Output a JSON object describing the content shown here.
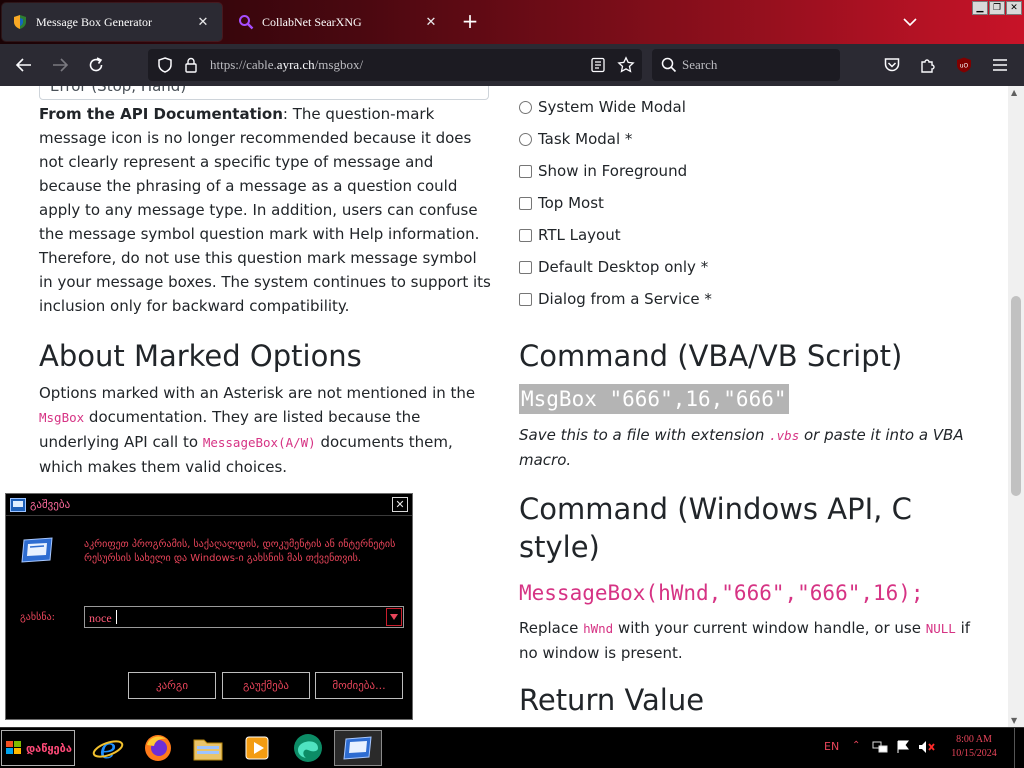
{
  "browser": {
    "tabs": [
      {
        "title": "Message Box Generator",
        "active": true,
        "icon": "shield-favicon"
      },
      {
        "title": "CollabNet SearXNG",
        "active": false,
        "icon": "search-favicon"
      }
    ],
    "url": {
      "prefix": "https://cable.",
      "domain": "ayra.ch",
      "path": "/msgbox/"
    },
    "search_placeholder": "Search"
  },
  "page": {
    "truncated_field": "Error (Stop, Hand)",
    "api_doc": {
      "heading": "From the API Documentation",
      "text": ": The question-mark message icon is no longer recommended because it does not clearly represent a specific type of message and because the phrasing of a message as a question could apply to any message type. In addition, users can confuse the message symbol question mark with Help information. Therefore, do not use this question mark message symbol in your message boxes. The system continues to support its inclusion only for backward compatibility."
    },
    "about": {
      "heading": "About Marked Options",
      "text_1": "Options marked with an Asterisk are not mentioned in the ",
      "code_1": "MsgBox",
      "text_2": " documentation. They are listed because the underlying API call to ",
      "code_2": "MessageBox(A/W)",
      "text_3": " documents them, which makes them valid choices."
    },
    "modality_options": [
      {
        "label": "System Wide Modal",
        "type": "radio",
        "checked": false
      },
      {
        "label": "Task Modal *",
        "type": "radio",
        "checked": false
      }
    ],
    "flag_options": [
      {
        "label": "Show in Foreground",
        "checked": false
      },
      {
        "label": "Top Most",
        "checked": false
      },
      {
        "label": "RTL Layout",
        "checked": false
      },
      {
        "label": "Default Desktop only *",
        "checked": false
      },
      {
        "label": "Dialog from a Service *",
        "checked": false
      }
    ],
    "vba": {
      "heading": "Command (VBA/VB Script)",
      "command": "MsgBox \"666\",16,\"666\"",
      "note_1": "Save this to a file with extension ",
      "note_code": ".vbs",
      "note_2": " or paste it into a VBA macro."
    },
    "winapi": {
      "heading": "Command (Windows API, C style)",
      "command": "MessageBox(hWnd,\"666\",\"666\",16);",
      "text_1": "Replace ",
      "code_1": "hWnd",
      "text_2": " with your current window handle, or use ",
      "code_2": "NULL",
      "text_3": " if no window is present."
    },
    "return_heading": "Return Value"
  },
  "run_dialog": {
    "title": "გაშვება",
    "description": "აკრიფეთ პროგრამის, საქაღალდის, დოკუმენტის ან ინტერნეტის რესურსის სახელი და Windows-ი გახსნის მას თქვენთვის.",
    "open_label": "გახსნა:",
    "input_value": "noce",
    "buttons": {
      "ok": "კარგი",
      "cancel": "გაუქმება",
      "browse": "მოძიება..."
    }
  },
  "taskbar": {
    "start_label": "დაწყება",
    "pinned": [
      "ie-icon",
      "firefox-icon",
      "explorer-icon",
      "media-player-icon",
      "edge-icon",
      "run-icon"
    ],
    "language": "EN",
    "time": "8:00 AM",
    "date": "10/15/2024"
  },
  "colors": {
    "tab_strip_start": "#1a0205",
    "tab_strip_end": "#c81328",
    "nav_bg": "#2b2a33",
    "code_pink": "#d63384",
    "dialog_text": "#e8455a",
    "highlight": "#b4b4b4"
  }
}
